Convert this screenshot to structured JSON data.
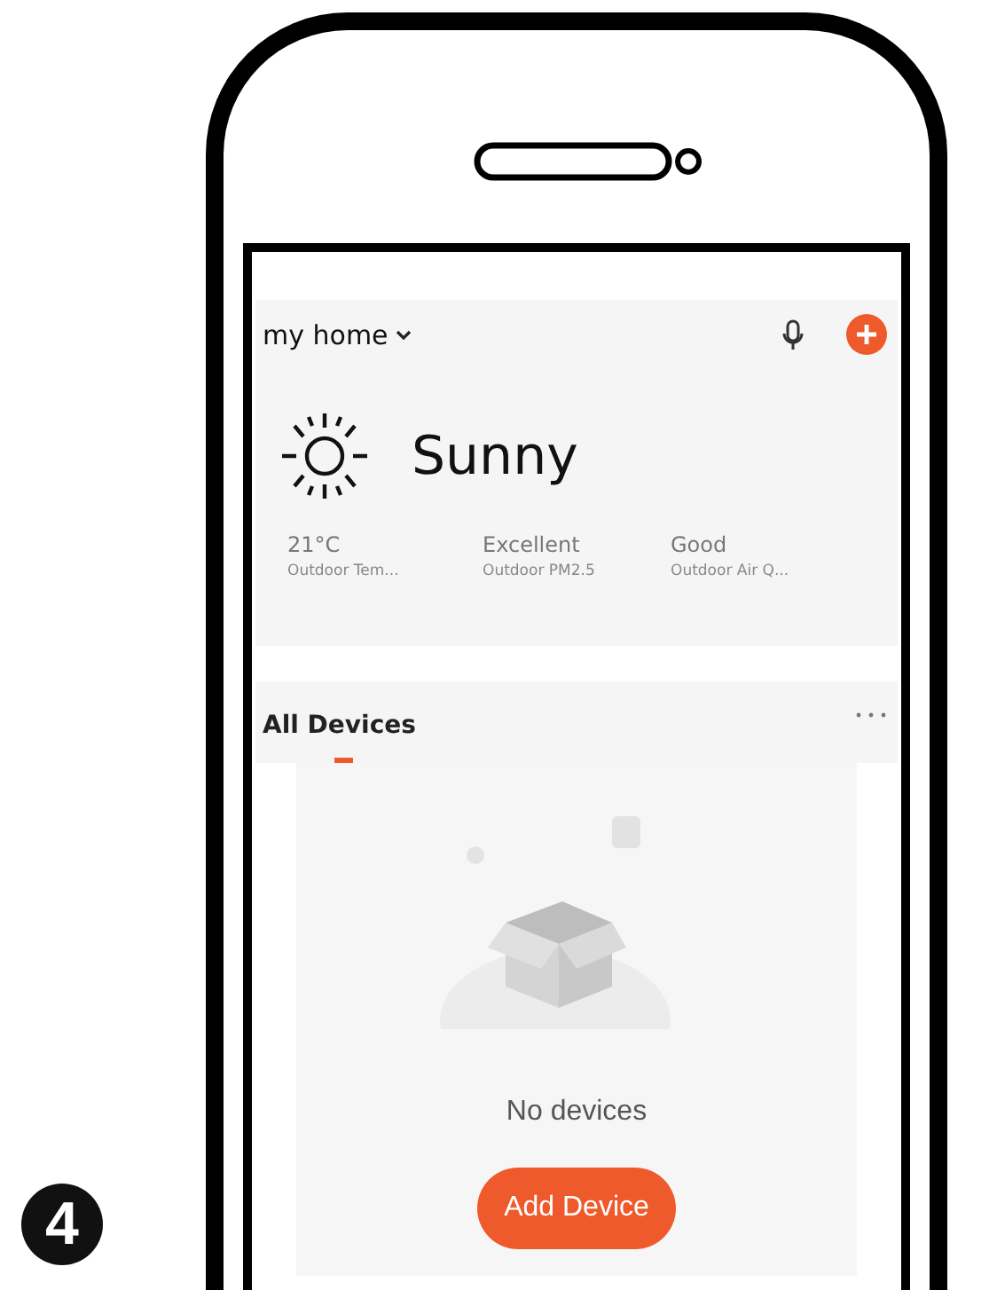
{
  "step": "4",
  "header": {
    "home": "my home"
  },
  "weather": {
    "condition": "Sunny",
    "stats": [
      {
        "value": "21°C",
        "label": "Outdoor Tem..."
      },
      {
        "value": "Excellent",
        "label": "Outdoor PM2.5"
      },
      {
        "value": "Good",
        "label": "Outdoor Air Q..."
      }
    ]
  },
  "tabs": [
    {
      "label": "All Devices",
      "selected": true
    }
  ],
  "empty_state": {
    "message": "No devices",
    "button": "Add Device"
  }
}
